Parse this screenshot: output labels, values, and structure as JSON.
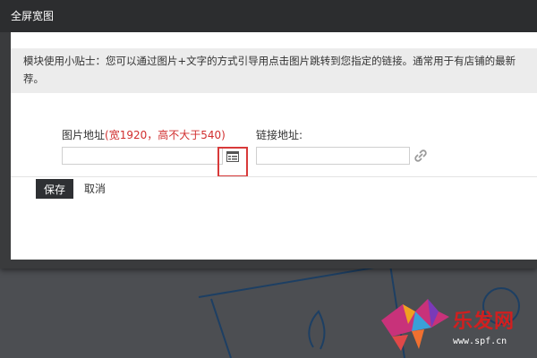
{
  "dialog": {
    "title": "全屏宽图"
  },
  "tips": {
    "line1": "模块使用小贴士：您可以通过图片+文字的方式引导用点击图片跳转到您指定的链接。通常用于有店铺的最新",
    "line2": "荐。"
  },
  "form": {
    "image_label": "图片地址",
    "image_hint": "(宽1920，高不大于540)",
    "image_value": "",
    "link_label": "链接地址:",
    "link_value": ""
  },
  "actions": {
    "save_label": "保存",
    "cancel_label": "取消"
  },
  "icons": {
    "picker": "image-picker-icon",
    "link": "link-chain-icon"
  },
  "watermark": {
    "logo_text": "乐发网",
    "url": "www.spf.cn"
  },
  "colors": {
    "titlebar": "#2c2d2f",
    "hint_red": "#d12e2e",
    "highlight_red": "#d83a3a",
    "save_button": "#2e3033",
    "tips_bg": "#ececec"
  }
}
